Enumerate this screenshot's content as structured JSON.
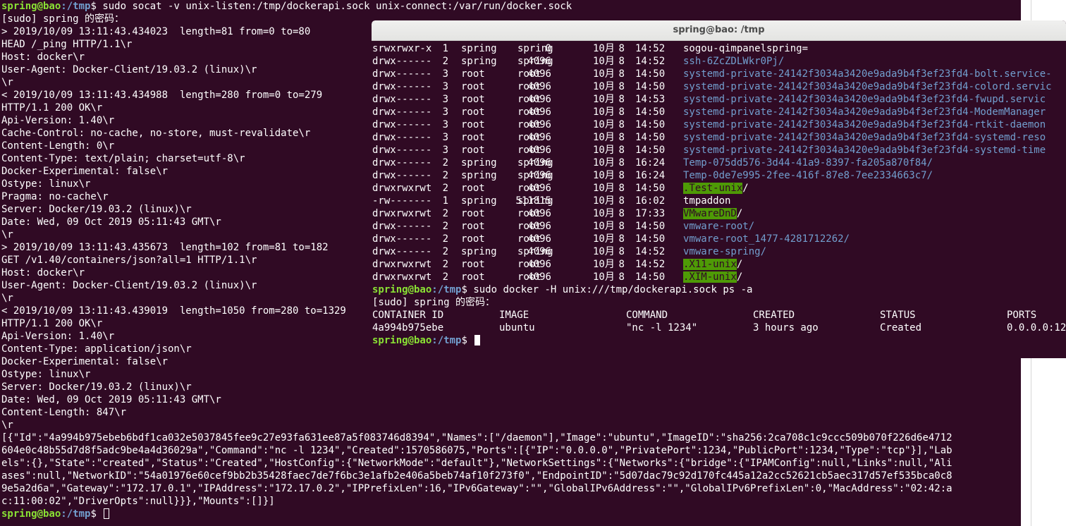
{
  "colors": {
    "background": "#300a24",
    "prompt_user": "#8ae234",
    "prompt_path": "#729fcf",
    "text": "#ffffff",
    "directory": "#729fcf",
    "sticky_dir_bg": "#4e9a06"
  },
  "back_terminal": {
    "command_line": {
      "user": "spring@bao",
      "path": ":/tmp",
      "dollar": "$ ",
      "cmd": "sudo socat -v unix-listen:/tmp/dockerapi.sock unix-connect:/var/run/docker.sock"
    },
    "lines": [
      "[sudo] spring 的密码：",
      "> 2019/10/09 13:11:43.434023  length=81 from=0 to=80",
      "HEAD /_ping HTTP/1.1\\r",
      "Host: docker\\r",
      "User-Agent: Docker-Client/19.03.2 (linux)\\r",
      "\\r",
      "< 2019/10/09 13:11:43.434988  length=280 from=0 to=279",
      "HTTP/1.1 200 OK\\r",
      "Api-Version: 1.40\\r",
      "Cache-Control: no-cache, no-store, must-revalidate\\r",
      "Content-Length: 0\\r",
      "Content-Type: text/plain; charset=utf-8\\r",
      "Docker-Experimental: false\\r",
      "Ostype: linux\\r",
      "Pragma: no-cache\\r",
      "Server: Docker/19.03.2 (linux)\\r",
      "Date: Wed, 09 Oct 2019 05:11:43 GMT\\r",
      "\\r",
      "> 2019/10/09 13:11:43.435673  length=102 from=81 to=182",
      "GET /v1.40/containers/json?all=1 HTTP/1.1\\r",
      "Host: docker\\r",
      "User-Agent: Docker-Client/19.03.2 (linux)\\r",
      "\\r",
      "< 2019/10/09 13:11:43.439019  length=1050 from=280 to=1329",
      "HTTP/1.1 200 OK\\r",
      "Api-Version: 1.40\\r",
      "Content-Type: application/json\\r",
      "Docker-Experimental: false\\r",
      "Ostype: linux\\r",
      "Server: Docker/19.03.2 (linux)\\r",
      "Date: Wed, 09 Oct 2019 05:11:43 GMT\\r",
      "Content-Length: 847\\r",
      "\\r",
      "[{\"Id\":\"4a994b975ebeb6bdf1ca032e5037845fee9c27e93fa631ee87a5f083746d8394\",\"Names\":[\"/daemon\"],\"Image\":\"ubuntu\",\"ImageID\":\"sha256:2ca708c1c9ccc509b070f226d6e4712",
      "604e0c48b55d7d8f5adc9be4a4d36029a\",\"Command\":\"nc -l 1234\",\"Created\":1570586075,\"Ports\":[{\"IP\":\"0.0.0.0\",\"PrivatePort\":1234,\"PublicPort\":1234,\"Type\":\"tcp\"}],\"Lab",
      "els\":{},\"State\":\"created\",\"Status\":\"Created\",\"HostConfig\":{\"NetworkMode\":\"default\"},\"NetworkSettings\":{\"Networks\":{\"bridge\":{\"IPAMConfig\":null,\"Links\":null,\"Ali",
      "ases\":null,\"NetworkID\":\"54a01976e60cef9bb2b35428faec7de7f6bc3e1afb2e406a5beb74af10f273f0\",\"EndpointID\":\"5d07dac79c92d170fc445a12a2cc52621cb5aec317d57ef535bca0c8",
      "9e5a2d6a\",\"Gateway\":\"172.17.0.1\",\"IPAddress\":\"172.17.0.2\",\"IPPrefixLen\":16,\"IPv6Gateway\":\"\",\"GlobalIPv6Address\":\"\",\"GlobalIPv6PrefixLen\":0,\"MacAddress\":\"02:42:a",
      "c:11:00:02\",\"DriverOpts\":null}}},\"Mounts\":[]}]"
    ],
    "final_prompt": {
      "user": "spring@bao",
      "path": ":/tmp",
      "dollar": "$ "
    }
  },
  "front_window": {
    "title": "spring@bao: /tmp",
    "listing": [
      {
        "perms": "srwxrwxr-x",
        "links": "1",
        "owner": "spring",
        "group": "spring",
        "size": "0",
        "month": "10月",
        "day": "8",
        "time": "14:52",
        "name": "sogou-qimpanelspring=",
        "kind": "socket"
      },
      {
        "perms": "drwx------",
        "links": "2",
        "owner": "spring",
        "group": "spring",
        "size": "4096",
        "month": "10月",
        "day": "8",
        "time": "14:52",
        "name": "ssh-6ZcZDLWkr0Pj/",
        "kind": "dir"
      },
      {
        "perms": "drwx------",
        "links": "3",
        "owner": "root",
        "group": "root",
        "size": "4096",
        "month": "10月",
        "day": "8",
        "time": "14:50",
        "name": "systemd-private-24142f3034a3420e9ada9b4f3ef23fd4-bolt.service-",
        "kind": "dir"
      },
      {
        "perms": "drwx------",
        "links": "3",
        "owner": "root",
        "group": "root",
        "size": "4096",
        "month": "10月",
        "day": "8",
        "time": "14:50",
        "name": "systemd-private-24142f3034a3420e9ada9b4f3ef23fd4-colord.servic",
        "kind": "dir"
      },
      {
        "perms": "drwx------",
        "links": "3",
        "owner": "root",
        "group": "root",
        "size": "4096",
        "month": "10月",
        "day": "8",
        "time": "14:53",
        "name": "systemd-private-24142f3034a3420e9ada9b4f3ef23fd4-fwupd.servic",
        "kind": "dir"
      },
      {
        "perms": "drwx------",
        "links": "3",
        "owner": "root",
        "group": "root",
        "size": "4096",
        "month": "10月",
        "day": "8",
        "time": "14:50",
        "name": "systemd-private-24142f3034a3420e9ada9b4f3ef23fd4-ModemManager",
        "kind": "dir"
      },
      {
        "perms": "drwx------",
        "links": "3",
        "owner": "root",
        "group": "root",
        "size": "4096",
        "month": "10月",
        "day": "8",
        "time": "14:50",
        "name": "systemd-private-24142f3034a3420e9ada9b4f3ef23fd4-rtkit-daemon",
        "kind": "dir"
      },
      {
        "perms": "drwx------",
        "links": "3",
        "owner": "root",
        "group": "root",
        "size": "4096",
        "month": "10月",
        "day": "8",
        "time": "14:50",
        "name": "systemd-private-24142f3034a3420e9ada9b4f3ef23fd4-systemd-reso",
        "kind": "dir"
      },
      {
        "perms": "drwx------",
        "links": "3",
        "owner": "root",
        "group": "root",
        "size": "4096",
        "month": "10月",
        "day": "8",
        "time": "14:50",
        "name": "systemd-private-24142f3034a3420e9ada9b4f3ef23fd4-systemd-time",
        "kind": "dir"
      },
      {
        "perms": "drwx------",
        "links": "2",
        "owner": "spring",
        "group": "spring",
        "size": "4096",
        "month": "10月",
        "day": "8",
        "time": "16:24",
        "name": "Temp-075dd576-3d44-41a9-8397-fa205a870f84/",
        "kind": "dir"
      },
      {
        "perms": "drwx------",
        "links": "2",
        "owner": "spring",
        "group": "spring",
        "size": "4096",
        "month": "10月",
        "day": "8",
        "time": "16:24",
        "name": "Temp-0de7e995-2fee-416f-87e8-7ee2334663c7/",
        "kind": "dir"
      },
      {
        "perms": "drwxrwxrwt",
        "links": "2",
        "owner": "root",
        "group": "root",
        "size": "4096",
        "month": "10月",
        "day": "8",
        "time": "14:50",
        "name": ".Test-unix",
        "suffix": "/",
        "kind": "sticky"
      },
      {
        "perms": "-rw-------",
        "links": "1",
        "owner": "spring",
        "group": "spring",
        "size": "511815",
        "month": "10月",
        "day": "8",
        "time": "16:02",
        "name": "tmpaddon",
        "kind": "file"
      },
      {
        "perms": "drwxrwxrwt",
        "links": "2",
        "owner": "root",
        "group": "root",
        "size": "4096",
        "month": "10月",
        "day": "8",
        "time": "17:33",
        "name": "VMwareDnD",
        "suffix": "/",
        "kind": "sticky"
      },
      {
        "perms": "drwx------",
        "links": "2",
        "owner": "root",
        "group": "root",
        "size": "4096",
        "month": "10月",
        "day": "8",
        "time": "14:50",
        "name": "vmware-root/",
        "kind": "dir"
      },
      {
        "perms": "drwx------",
        "links": "2",
        "owner": "root",
        "group": "root",
        "size": "4096",
        "month": "10月",
        "day": "8",
        "time": "14:50",
        "name": "vmware-root_1477-4281712262/",
        "kind": "dir"
      },
      {
        "perms": "drwx------",
        "links": "2",
        "owner": "spring",
        "group": "spring",
        "size": "4096",
        "month": "10月",
        "day": "8",
        "time": "14:52",
        "name": "vmware-spring/",
        "kind": "dir"
      },
      {
        "perms": "drwxrwxrwt",
        "links": "2",
        "owner": "root",
        "group": "root",
        "size": "4096",
        "month": "10月",
        "day": "8",
        "time": "14:52",
        "name": ".X11-unix",
        "suffix": "/",
        "kind": "sticky"
      },
      {
        "perms": "drwxrwxrwt",
        "links": "2",
        "owner": "root",
        "group": "root",
        "size": "4096",
        "month": "10月",
        "day": "8",
        "time": "14:50",
        "name": ".XIM-unix",
        "suffix": "/",
        "kind": "sticky"
      }
    ],
    "docker_command": {
      "user": "spring@bao",
      "path": ":/tmp",
      "dollar": "$ ",
      "cmd": "sudo docker -H unix:///tmp/dockerapi.sock ps -a"
    },
    "sudo_prompt": "[sudo] spring 的密码：",
    "ps_headers": [
      "CONTAINER ID",
      "IMAGE",
      "COMMAND",
      "CREATED",
      "STATUS",
      "PORTS"
    ],
    "ps_row": [
      "4a994b975ebe",
      "ubuntu",
      "\"nc -l 1234\"",
      "3 hours ago",
      "Created",
      "0.0.0.0:12"
    ],
    "final_prompt": {
      "user": "spring@bao",
      "path": ":/tmp",
      "dollar": "$ "
    }
  }
}
